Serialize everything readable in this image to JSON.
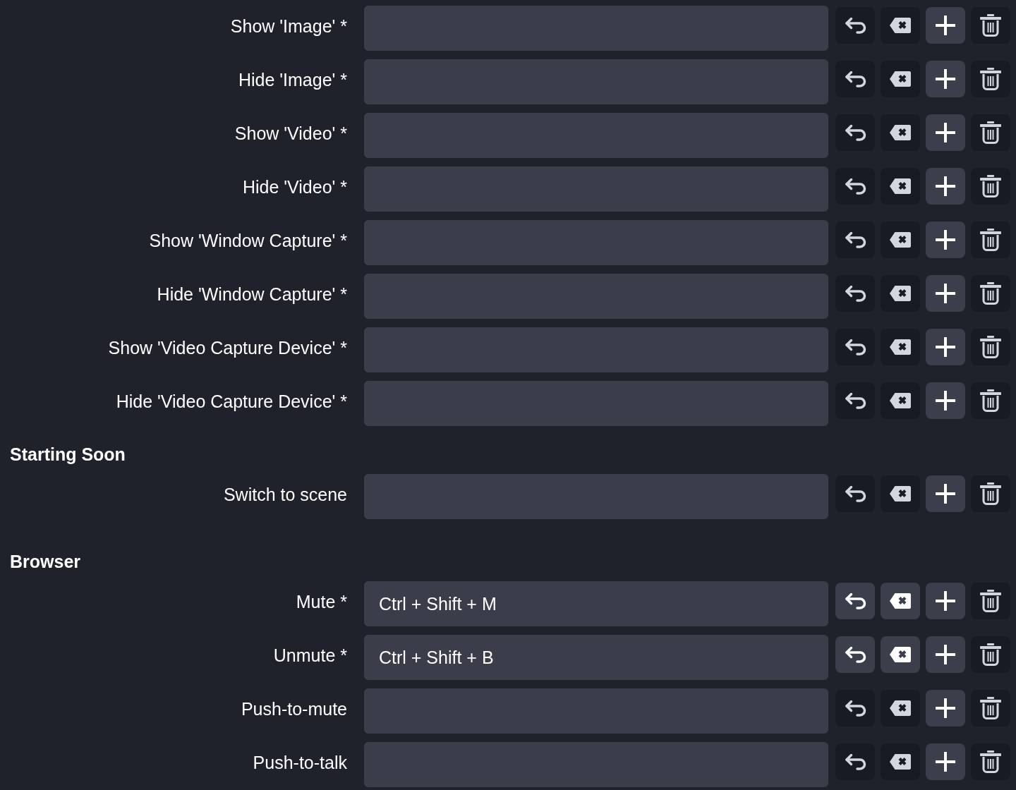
{
  "sections": [
    {
      "rows": [
        {
          "label": "Show 'Image' *",
          "buttons": [
            {
              "kind": "revert",
              "disabled": true
            },
            {
              "kind": "clear",
              "disabled": true
            },
            {
              "kind": "add",
              "disabled": false
            },
            {
              "kind": "remove",
              "disabled": true
            }
          ]
        },
        {
          "label": "Hide 'Image' *",
          "buttons": [
            {
              "kind": "revert",
              "disabled": true
            },
            {
              "kind": "clear",
              "disabled": true
            },
            {
              "kind": "add",
              "disabled": false
            },
            {
              "kind": "remove",
              "disabled": true
            }
          ]
        },
        {
          "label": "Show 'Video' *",
          "buttons": [
            {
              "kind": "revert",
              "disabled": true
            },
            {
              "kind": "clear",
              "disabled": true
            },
            {
              "kind": "add",
              "disabled": false
            },
            {
              "kind": "remove",
              "disabled": true
            }
          ]
        },
        {
          "label": "Hide 'Video' *",
          "buttons": [
            {
              "kind": "revert",
              "disabled": true
            },
            {
              "kind": "clear",
              "disabled": true
            },
            {
              "kind": "add",
              "disabled": false
            },
            {
              "kind": "remove",
              "disabled": true
            }
          ]
        },
        {
          "label": "Show 'Window Capture' *",
          "buttons": [
            {
              "kind": "revert",
              "disabled": true
            },
            {
              "kind": "clear",
              "disabled": true
            },
            {
              "kind": "add",
              "disabled": false
            },
            {
              "kind": "remove",
              "disabled": true
            }
          ]
        },
        {
          "label": "Hide 'Window Capture' *",
          "buttons": [
            {
              "kind": "revert",
              "disabled": true
            },
            {
              "kind": "clear",
              "disabled": true
            },
            {
              "kind": "add",
              "disabled": false
            },
            {
              "kind": "remove",
              "disabled": true
            }
          ]
        },
        {
          "label": "Show 'Video Capture Device' *",
          "buttons": [
            {
              "kind": "revert",
              "disabled": true
            },
            {
              "kind": "clear",
              "disabled": true
            },
            {
              "kind": "add",
              "disabled": false
            },
            {
              "kind": "remove",
              "disabled": true
            }
          ]
        },
        {
          "label": "Hide 'Video Capture Device' *",
          "buttons": [
            {
              "kind": "revert",
              "disabled": true
            },
            {
              "kind": "clear",
              "disabled": true
            },
            {
              "kind": "add",
              "disabled": false
            },
            {
              "kind": "remove",
              "disabled": true
            }
          ]
        }
      ]
    },
    {
      "title": "Starting Soon",
      "rows": [
        {
          "label": "Switch to scene",
          "buttons": [
            {
              "kind": "revert",
              "disabled": true
            },
            {
              "kind": "clear",
              "disabled": true
            },
            {
              "kind": "add",
              "disabled": false
            },
            {
              "kind": "remove",
              "disabled": true
            }
          ]
        }
      ]
    },
    {
      "title": "Browser",
      "rows": [
        {
          "label": "Mute *",
          "value": "Ctrl + Shift + M",
          "buttons": [
            {
              "kind": "revert",
              "disabled": false
            },
            {
              "kind": "clear",
              "disabled": false
            },
            {
              "kind": "add",
              "disabled": false
            },
            {
              "kind": "remove",
              "disabled": true
            }
          ]
        },
        {
          "label": "Unmute *",
          "value": "Ctrl + Shift + B",
          "buttons": [
            {
              "kind": "revert",
              "disabled": false
            },
            {
              "kind": "clear",
              "disabled": false
            },
            {
              "kind": "add",
              "disabled": false
            },
            {
              "kind": "remove",
              "disabled": true
            }
          ]
        },
        {
          "label": "Push-to-mute",
          "buttons": [
            {
              "kind": "revert",
              "disabled": true
            },
            {
              "kind": "clear",
              "disabled": true
            },
            {
              "kind": "add",
              "disabled": false
            },
            {
              "kind": "remove",
              "disabled": true
            }
          ]
        },
        {
          "label": "Push-to-talk",
          "buttons": [
            {
              "kind": "revert",
              "disabled": true
            },
            {
              "kind": "clear",
              "disabled": true
            },
            {
              "kind": "add",
              "disabled": false
            },
            {
              "kind": "remove",
              "disabled": true
            }
          ]
        }
      ]
    }
  ]
}
